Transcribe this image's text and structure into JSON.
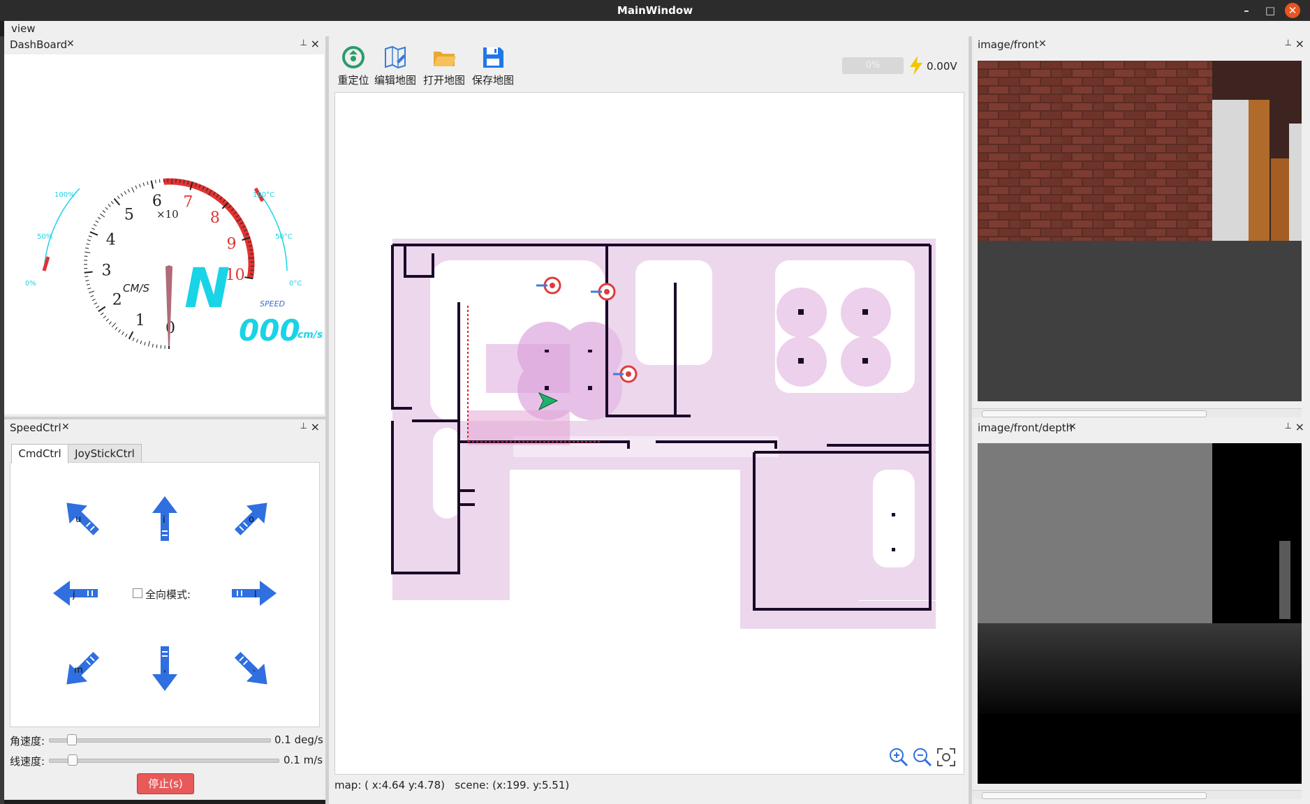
{
  "window": {
    "title": "MainWindow"
  },
  "menu": {
    "view": "view"
  },
  "dashboard": {
    "title": "DashBoard",
    "close_x": "✕",
    "gauge": {
      "numbers": [
        "0",
        "1",
        "2",
        "3",
        "4",
        "5",
        "6",
        "7",
        "8",
        "9",
        "10"
      ],
      "multiplier": "×10",
      "unit_label": "CM/S",
      "gear": "N",
      "speed_caption": "SPEED",
      "speed_value": "000",
      "speed_unit": "cm/s",
      "battery_labels": [
        "0%",
        "50%",
        "100%"
      ],
      "temp_labels": [
        "0°C",
        "50°C",
        "100°C"
      ],
      "speed": 0
    }
  },
  "speedctrl": {
    "title": "SpeedCtrl",
    "close_x": "✕",
    "tabs": [
      "CmdCtrl",
      "JoyStickCtrl"
    ],
    "keys": {
      "u": "u",
      "i": "i",
      "o": "o",
      "j": "j",
      "l": "l",
      "m": "m",
      "comma": ",",
      "dot": "."
    },
    "omni_label": "全向模式:",
    "angular_label": "角速度:",
    "angular_value": "0.1 deg/s",
    "angular_fraction": 0.1,
    "linear_label": "线速度:",
    "linear_value": "0.1 m/s",
    "linear_fraction": 0.1,
    "stop_label": "停止(s)"
  },
  "toolbar": {
    "relocate": "重定位",
    "edit_map": "编辑地图",
    "open_map": "打开地图",
    "save_map": "保存地图",
    "battery_percent": "0%",
    "voltage": "0.00V"
  },
  "status": {
    "map_label": "map:",
    "map_coords": "( x:4.64 y:4.78)",
    "scene_label": "scene:",
    "scene_coords": "(x:199. y:5.51)"
  },
  "image_front": {
    "title": "image/front",
    "close_x": "✕"
  },
  "image_depth": {
    "title": "image/front/depth",
    "close_x": "✕"
  },
  "colors": {
    "accent_blue": "#2f6fe0",
    "gauge_red": "#e03333",
    "cyan": "#19d3e6",
    "stop_red": "#e85a5a"
  }
}
